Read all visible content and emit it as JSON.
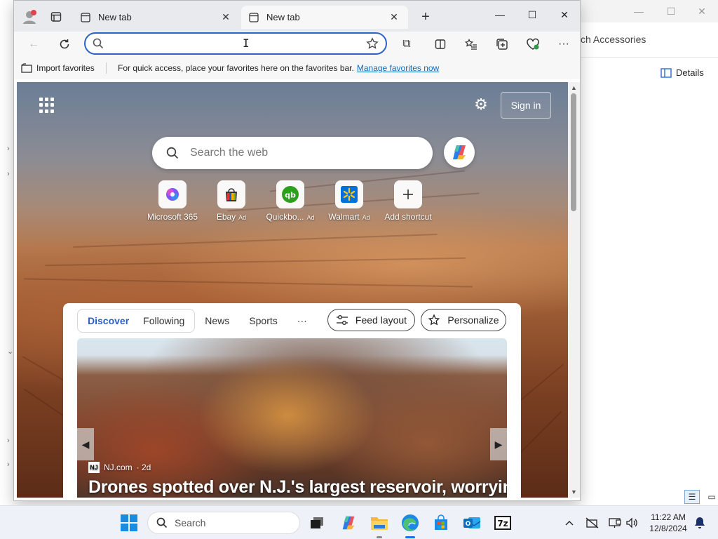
{
  "background_window": {
    "breadcrumb": "ch Accessories",
    "details_label": "Details"
  },
  "edge": {
    "tabs": [
      {
        "title": "New tab",
        "active": false
      },
      {
        "title": "New tab",
        "active": true
      }
    ],
    "address": {
      "value": "",
      "placeholder": ""
    },
    "favorites_bar": {
      "import_label": "Import favorites",
      "message": "For quick access, place your favorites here on the favorites bar.",
      "manage_link": "Manage favorites now"
    }
  },
  "new_tab_page": {
    "signin_label": "Sign in",
    "search_placeholder": "Search the web",
    "shortcuts": [
      {
        "label": "Microsoft 365",
        "ad": "",
        "icon": "microsoft-365-icon"
      },
      {
        "label": "Ebay",
        "ad": "Ad",
        "icon": "ebay-icon"
      },
      {
        "label": "Quickbo...",
        "ad": "Ad",
        "icon": "quickbooks-icon"
      },
      {
        "label": "Walmart",
        "ad": "Ad",
        "icon": "walmart-icon"
      },
      {
        "label": "Add shortcut",
        "ad": "",
        "icon": "plus-icon"
      }
    ],
    "feed": {
      "pill_tabs": [
        "Discover",
        "Following"
      ],
      "tabs": [
        "News",
        "Sports"
      ],
      "more": "···",
      "feed_layout_label": "Feed layout",
      "personalize_label": "Personalize",
      "hero": {
        "source_logo": "NJ",
        "source": "NJ.com",
        "age": "· 2d",
        "headline": "Drones spotted over N.J.'s largest reservoir, worrying"
      }
    }
  },
  "taskbar": {
    "search_placeholder": "Search",
    "time": "11:22 AM",
    "date": "12/8/2024",
    "outlook_badge": "O",
    "sevenzip_label": "7z"
  },
  "colors": {
    "accent": "#2f62c8",
    "feed_active": "#2c5fbf",
    "link": "#0f6cbd"
  }
}
